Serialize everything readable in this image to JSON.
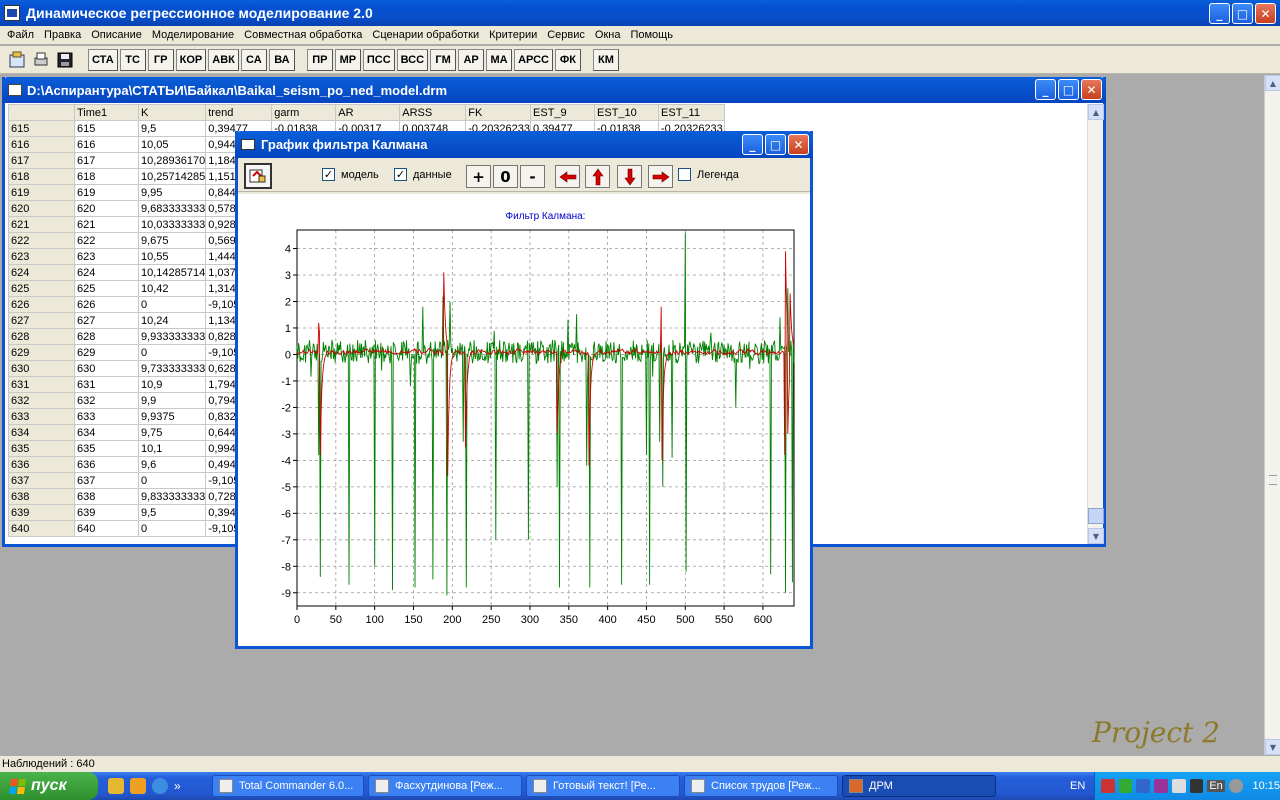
{
  "app": {
    "title": "Динамическое регрессионное моделирование 2.0",
    "menu": [
      "Файл",
      "Правка",
      "Описание",
      "Моделирование",
      "Совместная обработка",
      "Сценарии обработки",
      "Критерии",
      "Сервис",
      "Окна",
      "Помощь"
    ],
    "toolbar_group1": [
      "СТА",
      "ТС",
      "ГР",
      "КОР",
      "АВК",
      "СА",
      "ВА"
    ],
    "toolbar_group2": [
      "ПР",
      "МР",
      "ПСС",
      "ВСС",
      "ГМ",
      "АР",
      "МА",
      "АРСС",
      "ФК"
    ],
    "toolbar_group3": [
      "КМ"
    ],
    "window_buttons": {
      "minimize": "_",
      "maximize": "□",
      "close": "✕"
    }
  },
  "data_window": {
    "title": "D:\\Аспирантура\\СТАТЬИ\\Байкал\\Baikal_seism_po_ned_model.drm",
    "columns": [
      "",
      "Time1",
      "K",
      "trend",
      "garm",
      "AR",
      "ARSS",
      "FK",
      "EST_9",
      "EST_10",
      "EST_11"
    ],
    "rows": [
      [
        "615",
        "615",
        "9,5",
        "0,39477",
        "-0,01838",
        "-0,00317",
        "0,003748",
        "-0,20326233",
        "0,39477",
        "-0,01838",
        "-0,20326233"
      ],
      [
        "616",
        "616",
        "10,05",
        "0,9447"
      ],
      [
        "617",
        "617",
        "10,28936170",
        "1,1841"
      ],
      [
        "618",
        "618",
        "10,25714285",
        "1,1519"
      ],
      [
        "619",
        "619",
        "9,95",
        "0,8447"
      ],
      [
        "620",
        "620",
        "9,683333333",
        "0,5781"
      ],
      [
        "621",
        "621",
        "10,03333333",
        "0,9281"
      ],
      [
        "622",
        "622",
        "9,675",
        "0,5697"
      ],
      [
        "623",
        "623",
        "10,55",
        "1,4448"
      ],
      [
        "624",
        "624",
        "10,14285714",
        "1,0377"
      ],
      [
        "625",
        "625",
        "10,42",
        "1,3148"
      ],
      [
        "626",
        "626",
        "0",
        "-9,105"
      ],
      [
        "627",
        "627",
        "10,24",
        "1,1348"
      ],
      [
        "628",
        "628",
        "9,933333333",
        "0,8281"
      ],
      [
        "629",
        "629",
        "0",
        "-9,105"
      ],
      [
        "630",
        "630",
        "9,733333333",
        "0,6281"
      ],
      [
        "631",
        "631",
        "10,9",
        "1,7948"
      ],
      [
        "632",
        "632",
        "9,9",
        "0,7948"
      ],
      [
        "633",
        "633",
        "9,9375",
        "0,8323"
      ],
      [
        "634",
        "634",
        "9,75",
        "0,6448"
      ],
      [
        "635",
        "635",
        "10,1",
        "0,9948"
      ],
      [
        "636",
        "636",
        "9,6",
        "0,4948"
      ],
      [
        "637",
        "637",
        "0",
        "-9,105"
      ],
      [
        "638",
        "638",
        "9,833333333",
        "0,7281"
      ],
      [
        "639",
        "639",
        "9,5",
        "0,3948"
      ],
      [
        "640",
        "640",
        "0",
        "-9,105"
      ]
    ]
  },
  "kalman_window": {
    "title": "График фильтра Калмана",
    "check_model": "модель",
    "check_data": "данные",
    "check_legend": "Легенда",
    "btn_plus": "+",
    "btn_zero": "0",
    "btn_minus": "-",
    "model_checked": true,
    "data_checked": true,
    "legend_checked": false
  },
  "chart_data": {
    "type": "line",
    "title": "Фильтр Калмана:",
    "xlabel": "",
    "ylabel": "",
    "xlim": [
      0,
      640
    ],
    "ylim": [
      -9.5,
      4.7
    ],
    "xticks": [
      0,
      50,
      100,
      150,
      200,
      250,
      300,
      350,
      400,
      450,
      500,
      550,
      600
    ],
    "yticks": [
      4,
      3,
      2,
      1,
      0,
      -1,
      -2,
      -3,
      -4,
      -5,
      -6,
      -7,
      -8,
      -9
    ],
    "grid": true,
    "series": [
      {
        "color": "#008000",
        "style": "noisy",
        "baseline": 0.1,
        "noise": 0.45,
        "spikes": [
          [
            28,
            -3.8
          ],
          [
            30,
            -8.4
          ],
          [
            67,
            -8.7
          ],
          [
            100,
            -8.0
          ],
          [
            123,
            -8.9
          ],
          [
            146,
            -1.2
          ],
          [
            152,
            -8.8
          ],
          [
            162,
            1.8
          ],
          [
            175,
            -8.5
          ],
          [
            188,
            2.2
          ],
          [
            193,
            -9.1
          ],
          [
            197,
            2.0
          ],
          [
            214,
            -3.3
          ],
          [
            218,
            -8.8
          ],
          [
            256,
            -7.0
          ],
          [
            298,
            -7.0
          ],
          [
            335,
            -5.0
          ],
          [
            338,
            -8.8
          ],
          [
            373,
            -4.2
          ],
          [
            377,
            -8.8
          ],
          [
            418,
            -8.7
          ],
          [
            450,
            -3.8
          ],
          [
            454,
            -8.7
          ],
          [
            467,
            -3.3
          ],
          [
            471,
            -5.0
          ],
          [
            483,
            -3.9
          ],
          [
            500,
            4.6
          ],
          [
            501,
            -8.2
          ],
          [
            565,
            -2.0
          ],
          [
            610,
            -8.3
          ],
          [
            622,
            1.4
          ],
          [
            629,
            -9.0
          ],
          [
            632,
            2.5
          ],
          [
            638,
            -8.6
          ]
        ]
      },
      {
        "color": "#cc0000",
        "style": "smooth",
        "baseline": 0.1,
        "noise": 0.18,
        "spikes": [
          [
            28,
            1.2
          ],
          [
            30,
            -3.8
          ],
          [
            189,
            3.1
          ],
          [
            194,
            -4.6
          ],
          [
            217,
            -3.5
          ],
          [
            335,
            -3.0
          ],
          [
            376,
            -4.2
          ],
          [
            470,
            -4.0
          ],
          [
            469,
            1.8
          ],
          [
            628,
            -3.8
          ],
          [
            629,
            3.9
          ],
          [
            632,
            -3.0
          ],
          [
            635,
            2.3
          ]
        ]
      }
    ]
  },
  "status": "Наблюдений : 640",
  "watermark": "Project 2",
  "taskbar": {
    "start": "пуск",
    "quicklaunch_more": "»",
    "tasks": [
      "Total Commander 6.0...",
      "Фасхутдинова [Реж...",
      "Готовый текст! [Ре...",
      "Список трудов [Реж...",
      "ДРМ"
    ],
    "lang": "EN",
    "tray_lang": "En",
    "clock": "10:15"
  }
}
